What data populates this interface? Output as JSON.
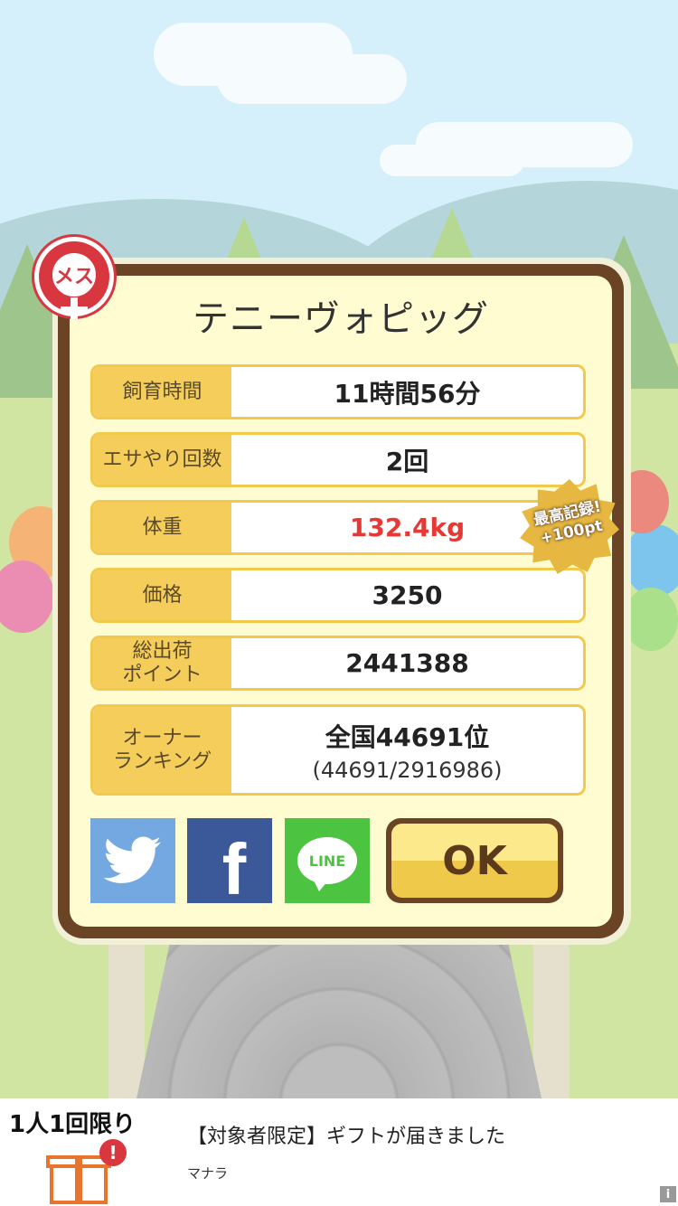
{
  "pet": {
    "gender_label": "メス",
    "name": "テニーヴォピッグ"
  },
  "stats": [
    {
      "label": "飼育時間",
      "value": "11時間56分"
    },
    {
      "label": "エサやり回数",
      "value": "2回"
    },
    {
      "label": "体重",
      "value": "132.4kg",
      "highlight_color": "#e53935"
    },
    {
      "label": "価格",
      "value": "3250"
    },
    {
      "label": "総出荷\nポイント",
      "value": "2441388"
    },
    {
      "label": "オーナー\nランキング",
      "value": "全国44691位",
      "sub": "(44691/2916986)"
    }
  ],
  "record_badge": {
    "line1": "最高記録!",
    "line2": "+100pt"
  },
  "share": {
    "twitter_icon": "twitter-bird-icon",
    "facebook_icon": "facebook-f-icon",
    "line_text": "LINE"
  },
  "ok_label": "OK",
  "ad": {
    "label": "1人1回限り",
    "title": "【対象者限定】ギフトが届きました",
    "sponsor": "マナラ",
    "alert": "!",
    "info": "i"
  },
  "colors": {
    "modal_border": "#6b4426",
    "label_bg": "#f5cd5b",
    "twitter": "#73a8e0",
    "facebook": "#3b5998",
    "line": "#4cc341"
  }
}
